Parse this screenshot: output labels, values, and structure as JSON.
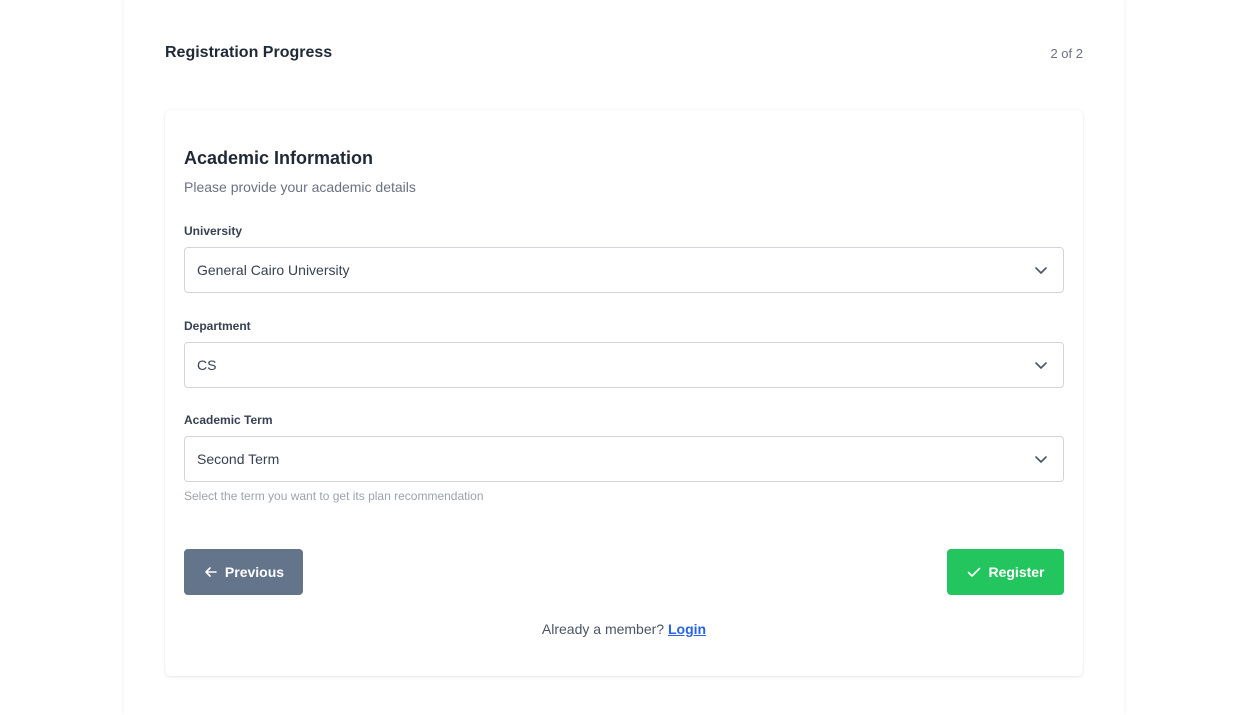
{
  "progress": {
    "title": "Registration Progress",
    "step": "2 of 2"
  },
  "form": {
    "title": "Academic Information",
    "subtitle": "Please provide your academic details",
    "fields": [
      {
        "label": "University",
        "value": "General Cairo University",
        "icon": "chevron-down-icon"
      },
      {
        "label": "Department",
        "value": "CS",
        "icon": "chevron-down-icon"
      },
      {
        "label": "Academic Term",
        "value": "Second Term",
        "icon": "chevron-down-icon"
      }
    ],
    "term_helper": "Select the term you want to get its plan recommendation"
  },
  "buttons": {
    "previous": {
      "label": "Previous",
      "icon": "arrow-left-icon",
      "color": "#64748b"
    },
    "register": {
      "label": "Register",
      "icon": "check-icon",
      "color": "#22c55e"
    }
  },
  "footer": {
    "prompt": "Already a member?",
    "login_label": "Login",
    "link_color": "#2563eb"
  }
}
